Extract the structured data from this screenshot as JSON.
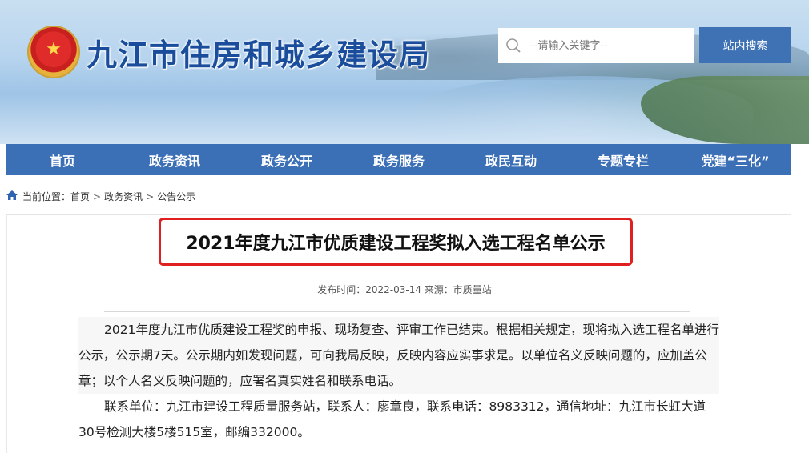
{
  "header": {
    "site_title": "九江市住房和城乡建设局",
    "emblem_icon": "national-emblem-icon",
    "search": {
      "placeholder": "--请输入关键字--",
      "button_label": "站内搜索"
    }
  },
  "nav": {
    "items": [
      "首页",
      "政务资讯",
      "政务公开",
      "政务服务",
      "政民互动",
      "专题专栏",
      "党建“三化”"
    ],
    "background": "#3b6fb6"
  },
  "breadcrumb": {
    "prefix": "当前位置：",
    "items": [
      "首页",
      "政务资讯",
      "公告公示"
    ],
    "separator": ">"
  },
  "article": {
    "title": "2021年度九江市优质建设工程奖拟入选工程名单公示",
    "highlight_color": "#e02020",
    "meta": "发布时间：2022-03-14  来源：市质量站",
    "paragraphs": [
      "2021年度九江市优质建设工程奖的申报、现场复查、评审工作已结束。根据相关规定，现将拟入选工程名单进行公示，公示期7天。公示期内如发现问题，可向我局反映，反映内容应实事求是。以单位名义反映问题的，应加盖公章；以个人名义反映问题的，应署名真实姓名和联系电话。",
      "联系单位：九江市建设工程质量服务站，联系人：廖章良，联系电话：8983312，通信地址：九江市长虹大道30号检测大楼5楼515室，邮编332000。"
    ]
  }
}
